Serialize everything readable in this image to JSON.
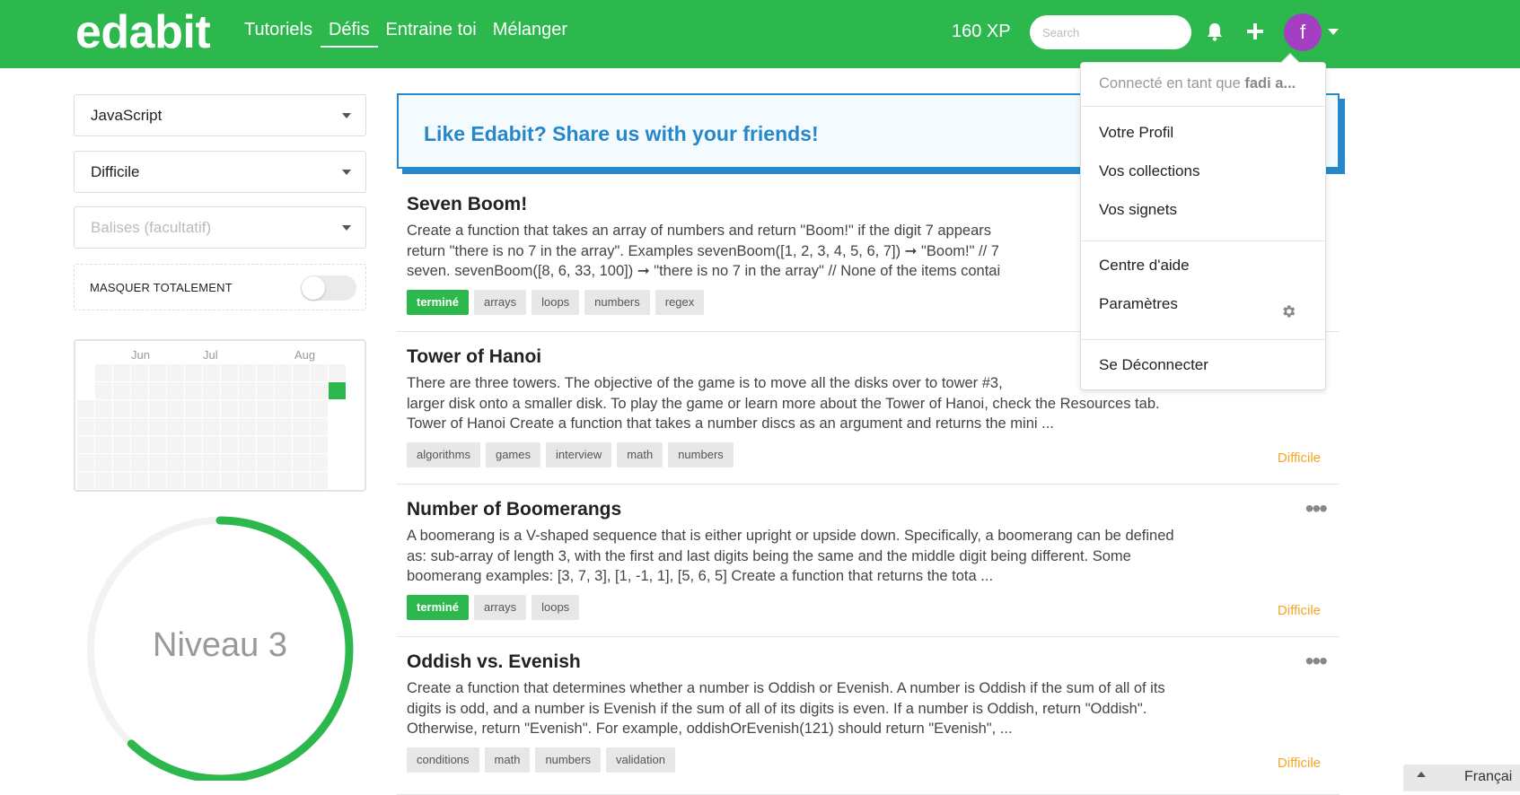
{
  "brand": {
    "logo": "edabit",
    "accent": "#2db84d"
  },
  "nav": {
    "items": [
      "Tutoriels",
      "Défis",
      "Entraine toi",
      "Mélanger"
    ],
    "active": "Défis"
  },
  "header": {
    "xp": "160 XP",
    "search_placeholder": "Search",
    "avatar_letter": "f"
  },
  "sidebar": {
    "language": "JavaScript",
    "difficulty": "Difficile",
    "tags_placeholder": "Balises (facultatif)",
    "hide_completed_label": "MASQUER TOTALEMENT",
    "hide_completed_on": false,
    "heatmap_months": [
      "Jun",
      "Jul",
      "Aug"
    ],
    "level_label": "Niveau 3",
    "level_progress": 0.62
  },
  "share_banner": {
    "text": "Like Edabit? Share us with your friends!"
  },
  "challenges": [
    {
      "title": "Seven Boom!",
      "desc": [
        "Create a function that takes an array of numbers and return \"Boom!\" if the digit 7 appears",
        "return \"there is no 7 in the array\". Examples sevenBoom([1, 2, 3, 4, 5, 6, 7]) ➞ \"Boom!\" // 7",
        "seven. sevenBoom([8, 6, 33, 100]) ➞ \"there is no 7 in the array\" // None of the items contai"
      ],
      "tags": [
        "terminé",
        "arrays",
        "loops",
        "numbers",
        "regex"
      ],
      "completed": true,
      "difficulty": ""
    },
    {
      "title": "Tower of Hanoi",
      "desc": [
        "There are three towers. The objective of the game is to move all the disks over to tower #3,",
        "larger disk onto a smaller disk. To play the game or learn more about the Tower of Hanoi, check the Resources tab.",
        "Tower of Hanoi Create a function that takes a number discs as an argument and returns the mini ..."
      ],
      "tags": [
        "algorithms",
        "games",
        "interview",
        "math",
        "numbers"
      ],
      "completed": false,
      "difficulty": "Difficile"
    },
    {
      "title": "Number of Boomerangs",
      "desc": [
        "A boomerang is a V-shaped sequence that is either upright or upside down. Specifically, a boomerang can be defined",
        "as: sub-array of length 3, with the first and last digits being the same and the middle digit being different. Some",
        "boomerang examples: [3, 7, 3], [1, -1, 1], [5, 6, 5] Create a function that returns the tota ..."
      ],
      "tags": [
        "terminé",
        "arrays",
        "loops"
      ],
      "completed": true,
      "difficulty": "Difficile"
    },
    {
      "title": "Oddish vs. Evenish",
      "desc": [
        "Create a function that determines whether a number is Oddish or Evenish. A number is Oddish if the sum of all of its",
        "digits is odd, and a number is Evenish if the sum of all of its digits is even. If a number is Oddish, return \"Oddish\".",
        "Otherwise, return \"Evenish\". For example, oddishOrEvenish(121) should return \"Evenish\", ..."
      ],
      "tags": [
        "conditions",
        "math",
        "numbers",
        "validation"
      ],
      "completed": false,
      "difficulty": "Difficile"
    }
  ],
  "user_menu": {
    "signed_in_prefix": "Connecté en tant que",
    "signed_in_user": "fadi a...",
    "items_group1": [
      "Votre Profil",
      "Vos collections",
      "Vos signets"
    ],
    "items_group2": [
      "Centre d'aide",
      "Paramètres"
    ],
    "logout": "Se Déconnecter"
  },
  "language_tab": {
    "label": "Françai"
  },
  "icons": {
    "bell": "bell-icon",
    "plus": "plus-icon",
    "gear": "gear-icon",
    "more": "more-dots-icon"
  }
}
